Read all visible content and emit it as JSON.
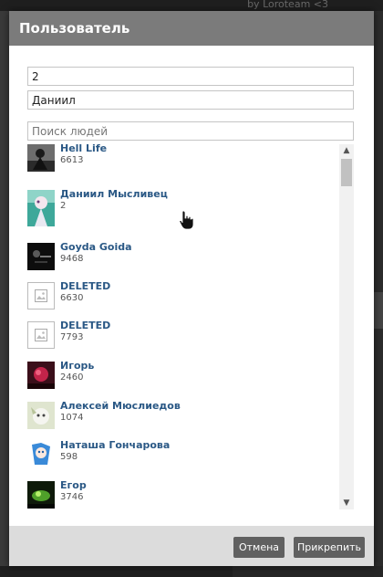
{
  "background": {
    "credit": "by Loroteam <3"
  },
  "dialog": {
    "title": "Пользователь",
    "field1_value": "2",
    "field2_value": "Даниил",
    "search_placeholder": "Поиск людей"
  },
  "users": [
    {
      "name": "Hell Life",
      "count": "6613",
      "avatar": "photo-dark"
    },
    {
      "name": "Даниил Мысливец",
      "count": "2",
      "avatar": "photo-anime-teal"
    },
    {
      "name": "Goyda Goida",
      "count": "9468",
      "avatar": "photo-black"
    },
    {
      "name": "DELETED",
      "count": "6630",
      "avatar": "placeholder-image-icon"
    },
    {
      "name": "DELETED",
      "count": "7793",
      "avatar": "placeholder-image-icon"
    },
    {
      "name": "Игорь",
      "count": "2460",
      "avatar": "photo-red"
    },
    {
      "name": "Алексей Мюслиедов",
      "count": "1074",
      "avatar": "photo-light"
    },
    {
      "name": "Наташа Гончарова",
      "count": "598",
      "avatar": "photo-anime-blue"
    },
    {
      "name": "Егор",
      "count": "3746",
      "avatar": "photo-green"
    }
  ],
  "buttons": {
    "cancel": "Отмена",
    "attach": "Прикрепить"
  },
  "colors": {
    "header": "#7b7b7b",
    "link": "#2a5885",
    "button": "#606060",
    "footer": "#dcdcdc"
  }
}
